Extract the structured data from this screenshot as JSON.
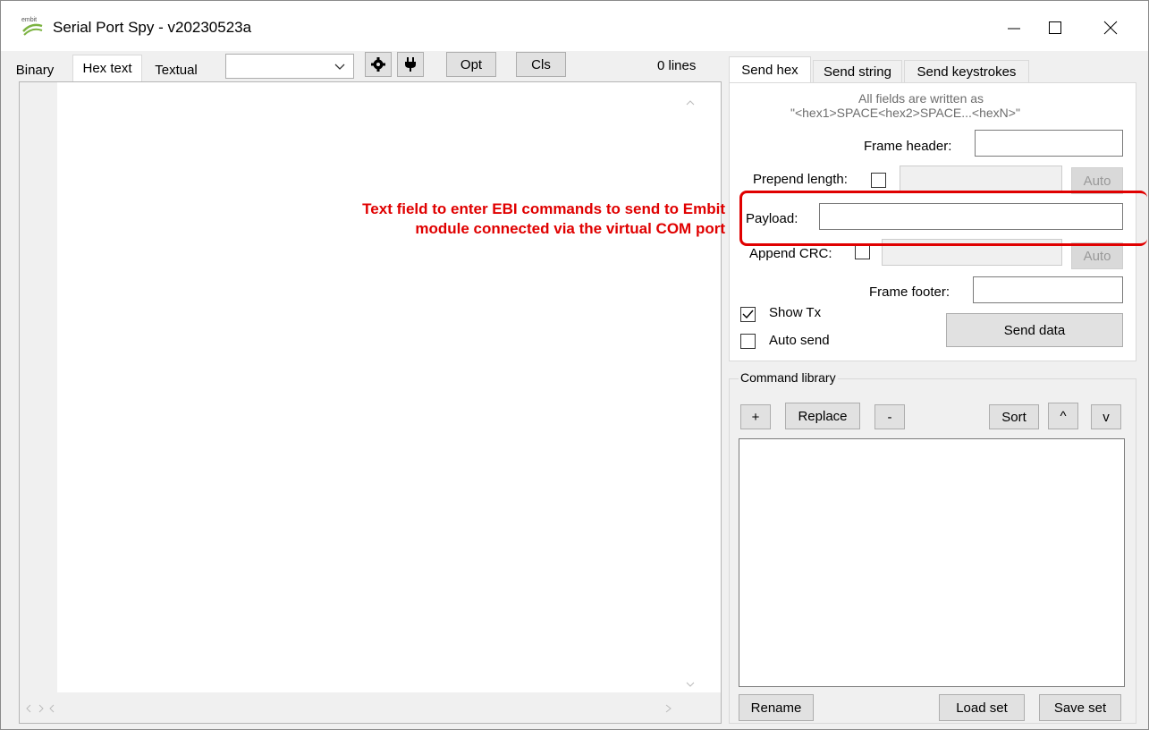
{
  "window": {
    "title": "Serial Port Spy - v20230523a",
    "logo_text": "embit"
  },
  "left": {
    "tabs": [
      {
        "label": "Binary"
      },
      {
        "label": "Hex text"
      },
      {
        "label": "Textual"
      }
    ],
    "dropdown_value": "",
    "opt_label": "Opt",
    "cls_label": "Cls",
    "lines_label": "0 lines"
  },
  "right": {
    "tabs": [
      {
        "label": "Send hex"
      },
      {
        "label": "Send string"
      },
      {
        "label": "Send keystrokes"
      }
    ],
    "hint_line1": "All fields are written as",
    "hint_line2": "\"<hex1>SPACE<hex2>SPACE...<hexN>\"",
    "frame_header_label": "Frame header:",
    "prepend_length_label": "Prepend length:",
    "auto_label": "Auto",
    "payload_label": "Payload:",
    "append_crc_label": "Append CRC:",
    "frame_footer_label": "Frame footer:",
    "show_tx_label": "Show Tx",
    "auto_send_label": "Auto send",
    "send_data_label": "Send data",
    "show_tx_checked": true,
    "auto_send_checked": false
  },
  "library": {
    "title": "Command library",
    "plus_label": "+",
    "replace_label": "Replace",
    "minus_label": "-",
    "sort_label": "Sort",
    "up_label": "^",
    "down_label": "v",
    "rename_label": "Rename",
    "load_label": "Load set",
    "save_label": "Save set"
  },
  "annotation": {
    "line1": "Text field to enter EBI commands to send to Embit",
    "line2": "module connected via the virtual COM port",
    "color": "#e00000"
  }
}
